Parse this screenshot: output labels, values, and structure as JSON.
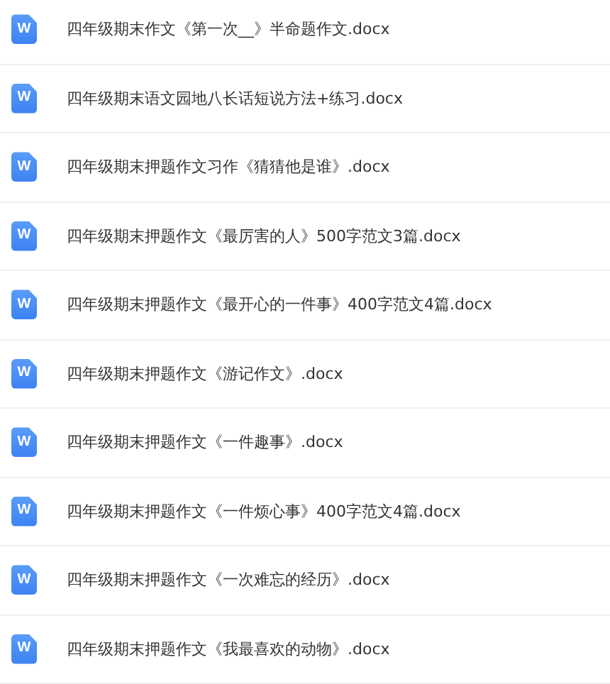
{
  "files": [
    {
      "icon_label": "W",
      "name": "四年级期末作文《第一次__》半命题作文.docx"
    },
    {
      "icon_label": "W",
      "name": "四年级期末语文园地八长话短说方法+练习.docx"
    },
    {
      "icon_label": "W",
      "name": "四年级期末押题作文习作《猜猜他是谁》.docx"
    },
    {
      "icon_label": "W",
      "name": "四年级期末押题作文《最厉害的人》500字范文3篇.docx"
    },
    {
      "icon_label": "W",
      "name": "四年级期末押题作文《最开心的一件事》400字范文4篇.docx"
    },
    {
      "icon_label": "W",
      "name": "四年级期末押题作文《游记作文》.docx"
    },
    {
      "icon_label": "W",
      "name": "四年级期末押题作文《一件趣事》.docx"
    },
    {
      "icon_label": "W",
      "name": "四年级期末押题作文《一件烦心事》400字范文4篇.docx"
    },
    {
      "icon_label": "W",
      "name": "四年级期末押题作文《一次难忘的经历》.docx"
    },
    {
      "icon_label": "W",
      "name": "四年级期末押题作文《我最喜欢的动物》.docx"
    }
  ]
}
